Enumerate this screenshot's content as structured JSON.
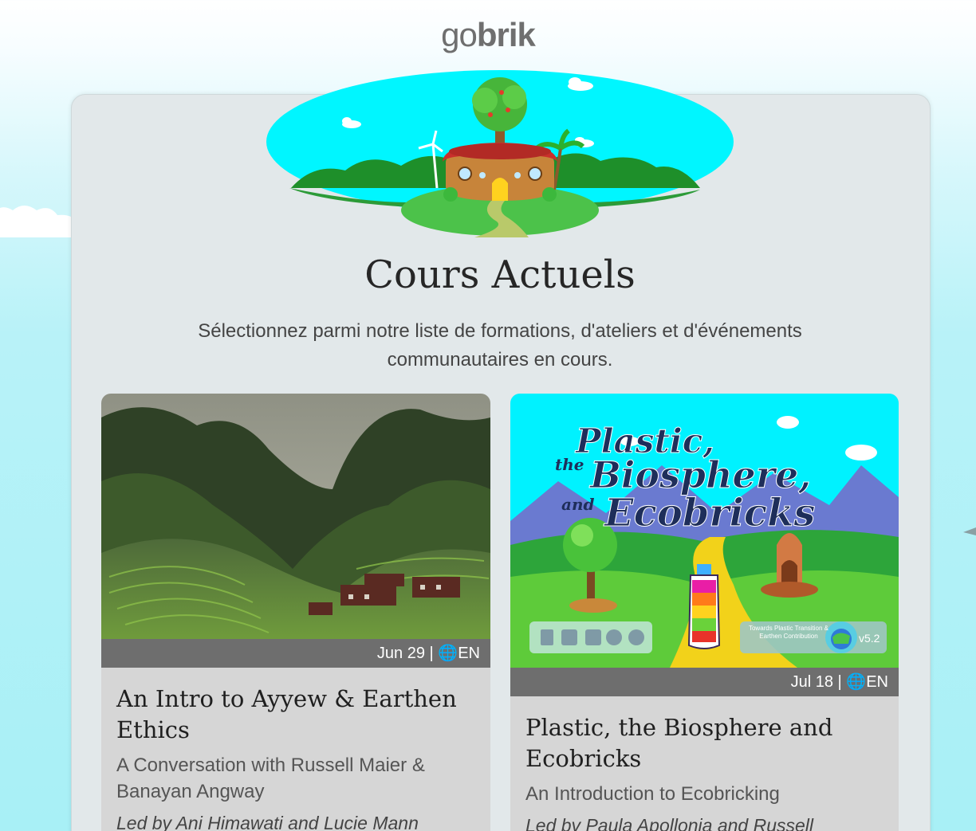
{
  "logo": {
    "light": "go",
    "bold": "brik"
  },
  "page": {
    "title": "Cours Actuels",
    "subtitle": "Sélectionnez parmi notre liste de formations, d'ateliers et d'événements communautaires en cours."
  },
  "courses": [
    {
      "date": "Jun 29",
      "separator": " | ",
      "language_icon": "🌐",
      "language": "EN",
      "title": "An Intro to Ayyew & Earthen Ethics",
      "subtitle": "A Conversation with Russell Maier & Banayan Angway",
      "led_by": "Led by Ani Himawati and Lucie Mann",
      "image_icon": "terraced-valley-photo"
    },
    {
      "date": "Jul 18",
      "separator": " | ",
      "language_icon": "🌐",
      "language": "EN",
      "title": "Plastic, the Biosphere and Ecobricks",
      "subtitle": "An Introduction to Ecobricking",
      "led_by": "Led by Paula Apollonia and Russell",
      "image_icon": "plastic-biosphere-poster",
      "poster": {
        "line1": "Plastic,",
        "line2_small": "the",
        "line2": "Biosphere,",
        "line3_small": "and",
        "line3": "Ecobricks",
        "badge_text": "Towards Plastic Transition & Earthen Contribution",
        "badge_version": "v5.2"
      }
    }
  ],
  "colors": {
    "panel": "#e2e8ea",
    "meta_bar": "#6e6e6e",
    "card": "#d6d6d6",
    "hero_sky": "#00f6ff",
    "grass": "#3cb83c"
  }
}
